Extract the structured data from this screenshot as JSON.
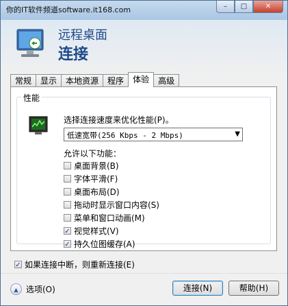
{
  "window": {
    "title": "你的IT软件频道software.it168.com",
    "caption_min": "–",
    "caption_max": "□",
    "caption_close": "✕"
  },
  "header": {
    "line1": "远程桌面",
    "line2": "连接"
  },
  "tabs": [
    {
      "label": "常规",
      "active": false
    },
    {
      "label": "显示",
      "active": false
    },
    {
      "label": "本地资源",
      "active": false
    },
    {
      "label": "程序",
      "active": false
    },
    {
      "label": "体验",
      "active": true
    },
    {
      "label": "高级",
      "active": false
    }
  ],
  "performance": {
    "group_label": "性能",
    "speed_label": "选择连接速度来优化性能(P)。",
    "speed_selected": "低速宽带(256 Kbps - 2 Mbps)",
    "allow_label": "允许以下功能：",
    "features": [
      {
        "label": "桌面背景(B)",
        "checked": false
      },
      {
        "label": "字体平滑(F)",
        "checked": false
      },
      {
        "label": "桌面布局(D)",
        "checked": false
      },
      {
        "label": "拖动时显示窗口内容(S)",
        "checked": false
      },
      {
        "label": "菜单和窗口动画(M)",
        "checked": false
      },
      {
        "label": "视觉样式(V)",
        "checked": true
      },
      {
        "label": "持久位图缓存(A)",
        "checked": true
      }
    ]
  },
  "reconnect": {
    "label": "如果连接中断，则重新连接(E)",
    "checked": true
  },
  "footer": {
    "options_label": "选项(O)",
    "connect_label": "连接(N)",
    "help_label": "帮助(H)"
  },
  "icons": {
    "check_mark": "✓",
    "dropdown_arrow": "▼",
    "options_toggle": "▲"
  }
}
